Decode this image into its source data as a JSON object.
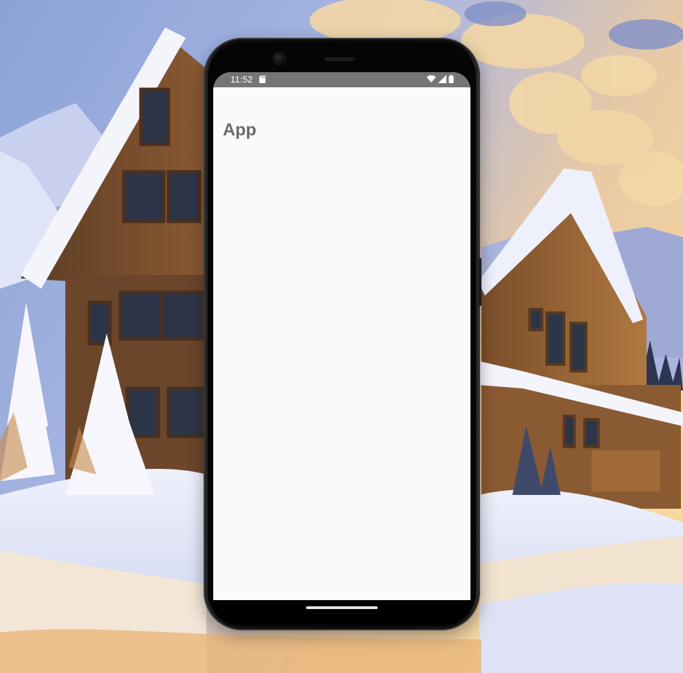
{
  "status_bar": {
    "time": "11:52",
    "icons": [
      "sd-card-icon",
      "wifi-icon",
      "cellular-signal-icon",
      "battery-icon"
    ],
    "background_color": "#757575"
  },
  "app": {
    "title": "App",
    "background_color": "#fafafa"
  },
  "navigation": {
    "home_indicator": "home-pill"
  }
}
